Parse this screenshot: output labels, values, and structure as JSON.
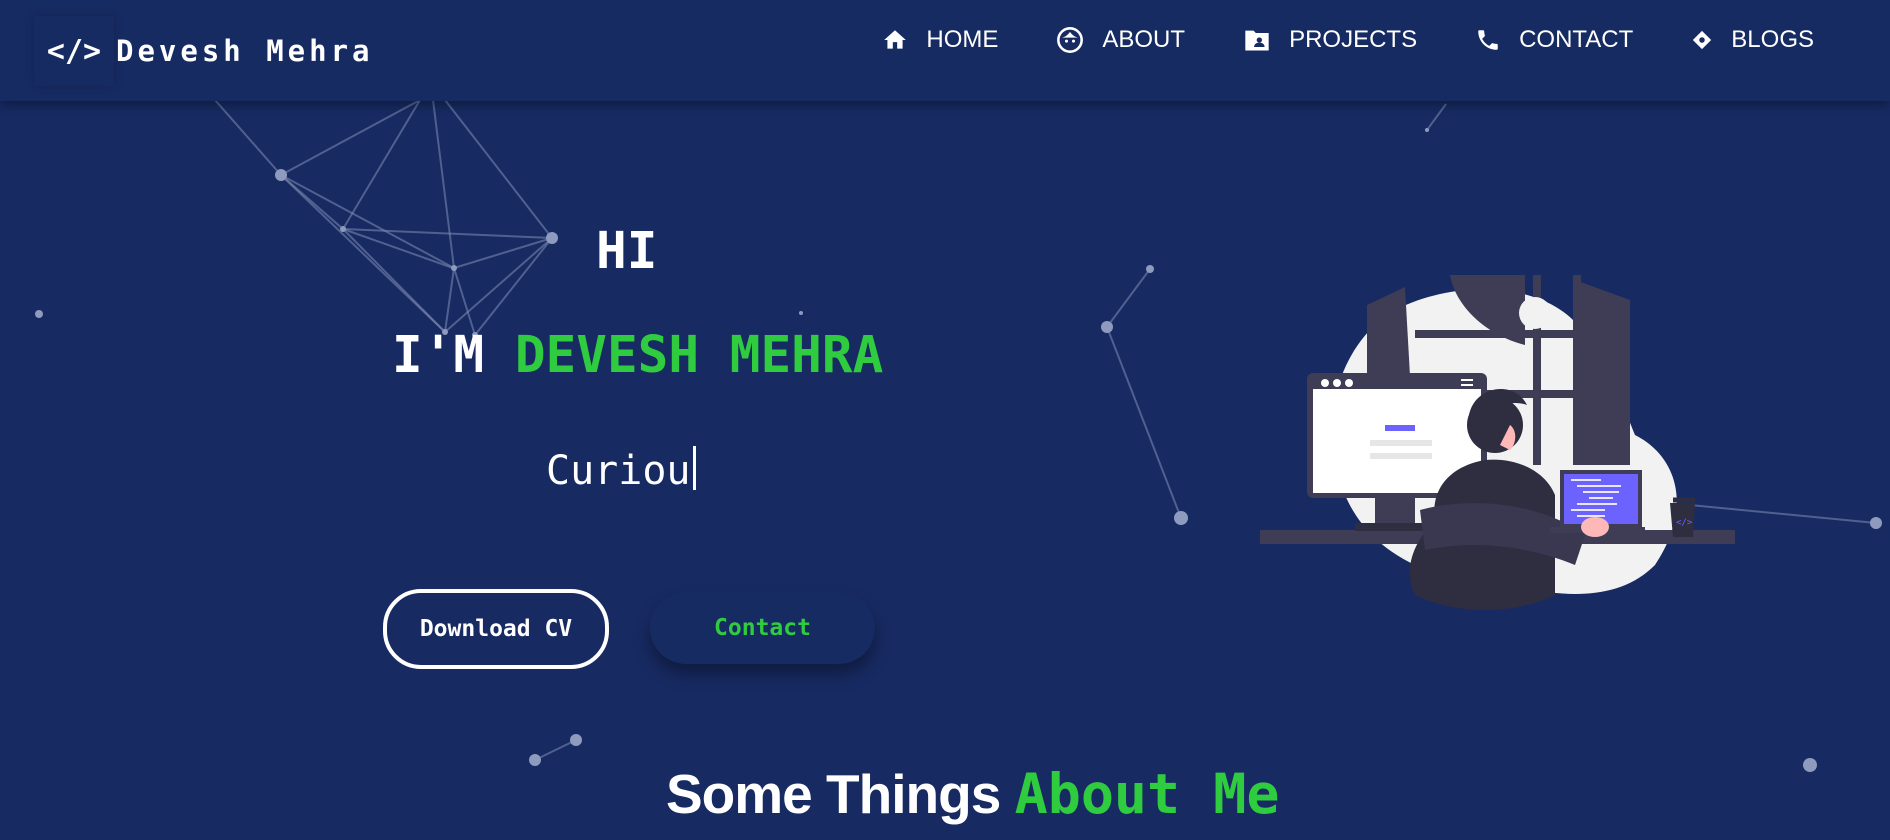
{
  "brand": {
    "icon_text": "</>",
    "name": "Devesh Mehra"
  },
  "nav": {
    "items": [
      {
        "label": "HOME",
        "icon": "home-icon"
      },
      {
        "label": "ABOUT",
        "icon": "face-icon"
      },
      {
        "label": "PROJECTS",
        "icon": "folder-icon"
      },
      {
        "label": "CONTACT",
        "icon": "phone-icon"
      },
      {
        "label": "BLOGS",
        "icon": "diamond-icon"
      }
    ]
  },
  "hero": {
    "greeting": "HI",
    "intro": "I'M",
    "name": "DEVESH MEHRA",
    "typed_text": "Curiou",
    "download_cv_label": "Download CV",
    "contact_label": "Contact"
  },
  "about_section": {
    "title_part1": "Some Things",
    "title_part2": "About Me"
  },
  "colors": {
    "background": "#172a62",
    "accent": "#2fcc3f",
    "text": "#ffffff"
  }
}
